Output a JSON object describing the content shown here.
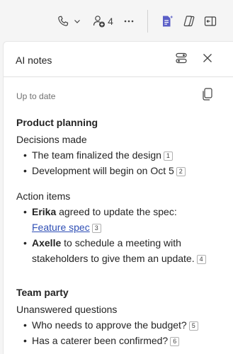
{
  "toolbar": {
    "participant_count": "4",
    "icons": [
      "phone-icon",
      "chevron-down-icon",
      "add-people-icon",
      "more-icon",
      "notes-icon",
      "copilot-icon",
      "panel-icon"
    ],
    "accent_color": "#5b5fc7"
  },
  "panel": {
    "title": "AI notes",
    "status": "Up to date"
  },
  "sections": [
    {
      "title": "Product planning",
      "groups": [
        {
          "heading": "Decisions made",
          "items": [
            {
              "text": "The team finalized the design",
              "ref": "1"
            },
            {
              "text": "Development will begin on Oct 5",
              "ref": "2"
            }
          ]
        },
        {
          "heading": "Action items",
          "items": [
            {
              "person": "Erika",
              "text": " agreed to update the spec:",
              "link": "Feature spec",
              "ref": "3"
            },
            {
              "person": "Axelle",
              "text": " to schedule a meeting with stakeholders to give them an update.",
              "ref": "4"
            }
          ]
        }
      ]
    },
    {
      "title": "Team party",
      "groups": [
        {
          "heading": "Unanswered questions",
          "items": [
            {
              "text": "Who needs to approve the budget?",
              "ref": "5"
            },
            {
              "text": "Has a caterer been confirmed?",
              "ref": "6"
            }
          ]
        }
      ]
    }
  ]
}
